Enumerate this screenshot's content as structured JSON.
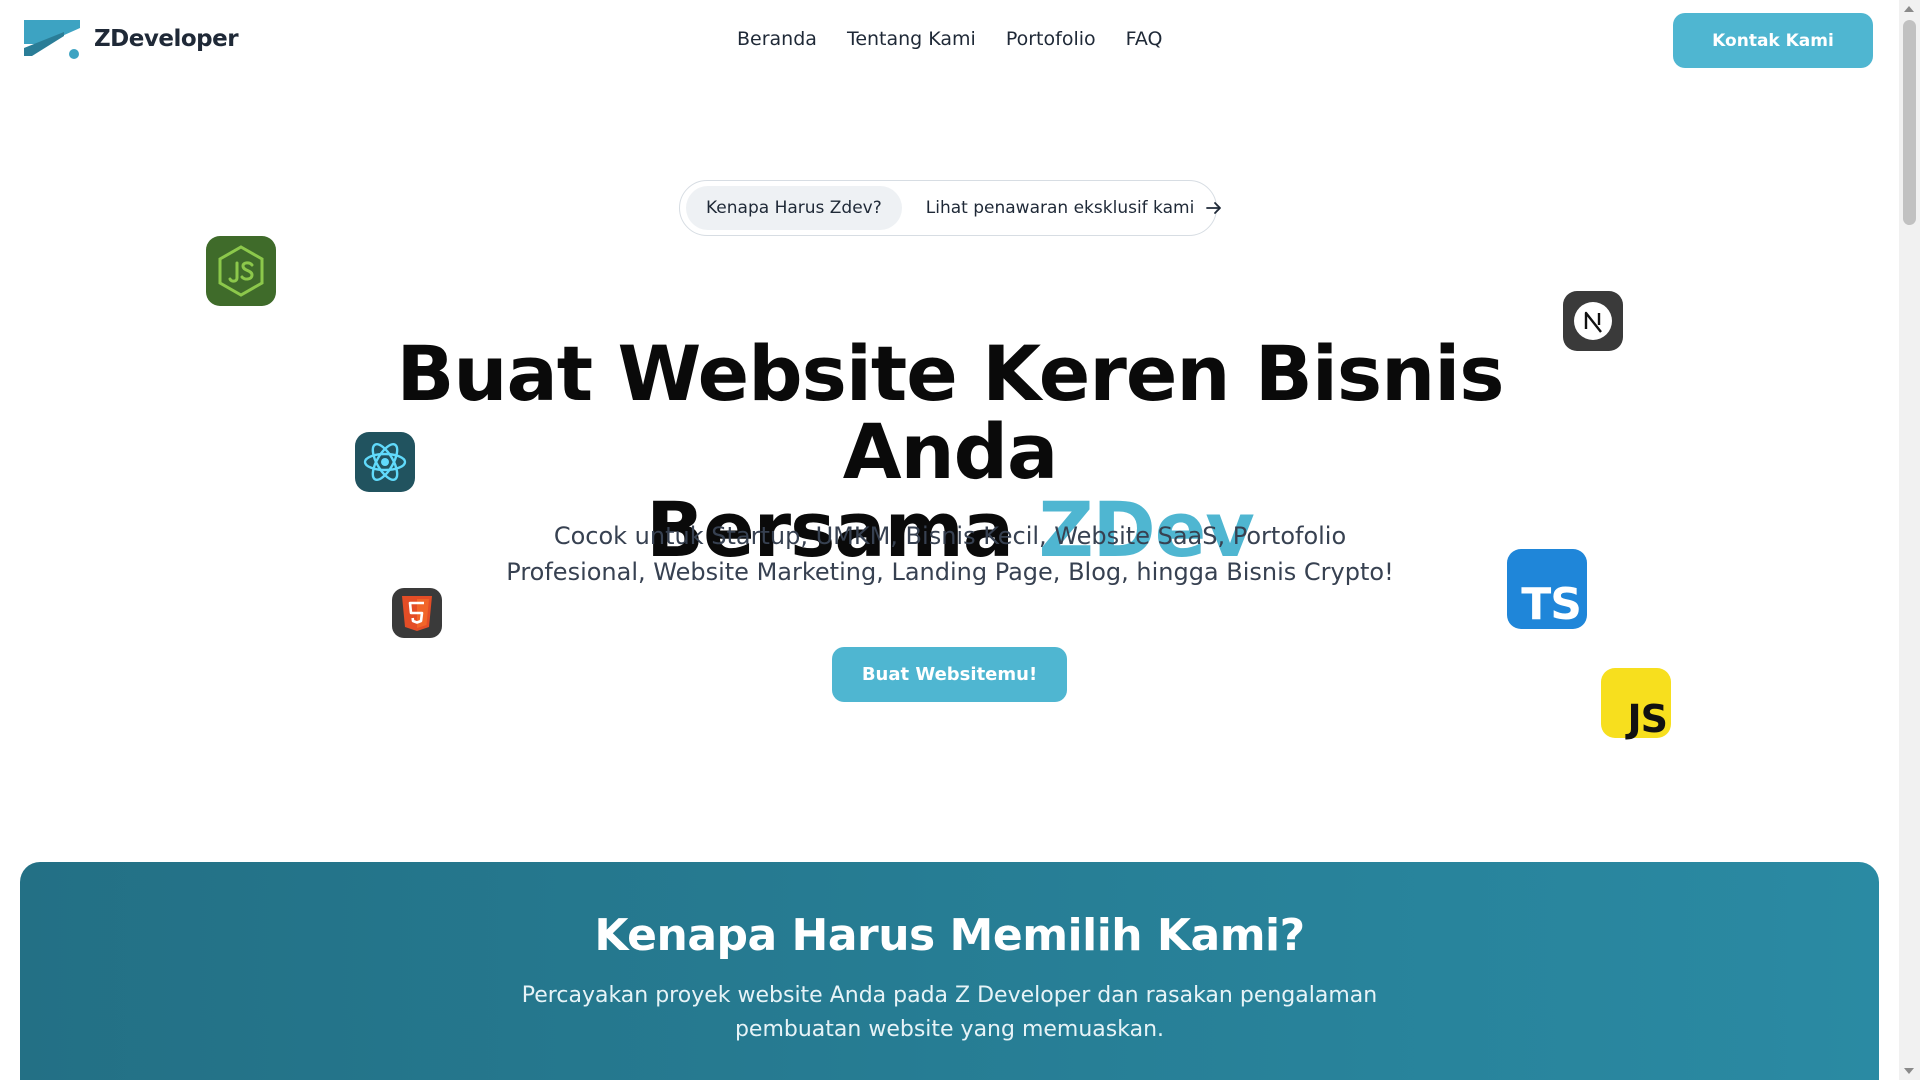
{
  "header": {
    "logo_text": "ZDeveloper",
    "nav": [
      "Beranda",
      "Tentang Kami",
      "Portofolio",
      "FAQ"
    ],
    "contact_label": "Kontak Kami"
  },
  "announcement": {
    "tag": "Kenapa Harus Zdev?",
    "link": "Lihat penawaran eksklusif kami"
  },
  "hero": {
    "title_line1": "Buat Website Keren Bisnis Anda",
    "title_line2_prefix": "Bersama ",
    "title_accent": "ZDev",
    "subtitle": "Cocok untuk Startup, UMKM, Bisnis Kecil, Website SaaS, Portofolio Profesional, Website Marketing, Landing Page, Blog, hingga Bisnis Crypto!",
    "cta_label": "Buat Websitemu!"
  },
  "tech_icons": [
    "nodejs-icon",
    "react-icon",
    "html5-icon",
    "nextjs-icon",
    "typescript-icon",
    "javascript-icon"
  ],
  "tech_labels": {
    "typescript": "TS",
    "javascript": "JS"
  },
  "section": {
    "title": "Kenapa Harus Memilih Kami?",
    "description": "Percayakan proyek website Anda pada Z Developer dan rasakan pengalaman pembuatan website yang memuaskan."
  },
  "colors": {
    "accent": "#4fb6d1",
    "section_start": "#237085",
    "section_end": "#2a8aa3"
  }
}
